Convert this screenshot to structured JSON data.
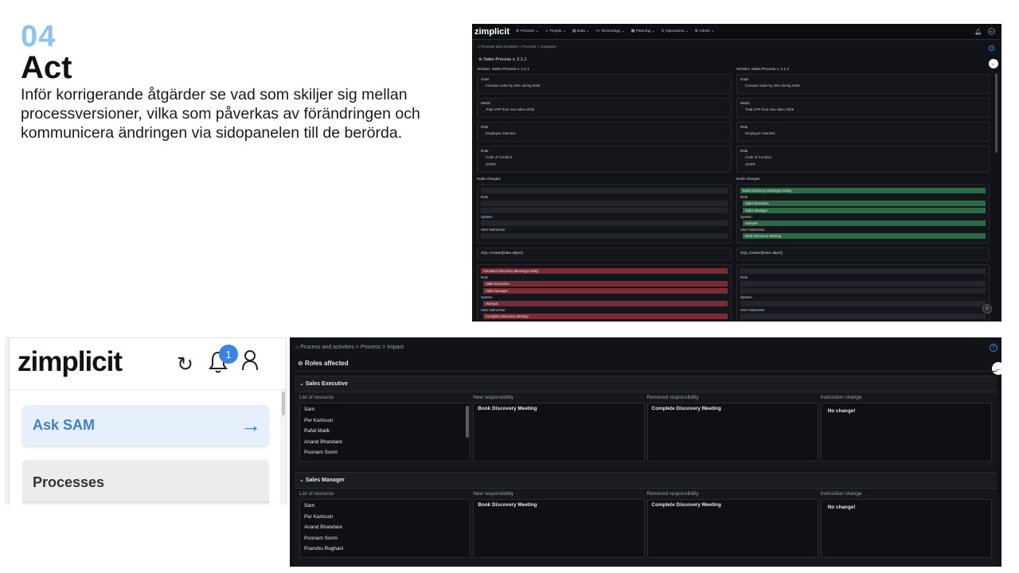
{
  "slide": {
    "number": "04",
    "title": "Act",
    "description": "Inför korrigerande åtgärder se vad som skiljer sig mellan processversioner, vilka som påverkas av förändringen och kommunicera ändringen via sidopanelen till de berörda."
  },
  "compare": {
    "logo": "zimplicit",
    "nav": [
      "Process",
      "People",
      "Data",
      "Technology",
      "Planning",
      "Operations",
      "Admin"
    ],
    "avatar": "MJ",
    "breadcrumb": "Process and activities  >  Process  >  Compare",
    "page_title": "Sales Process v. 2.1.1",
    "left": {
      "version": "Version: Sales Process v. 2.1.1",
      "goal_label": "Goal",
      "goal": "Increase sales by 25% during 2025",
      "metric_label": "Metric",
      "metric": "Total APR from new sales 2025",
      "risk_label": "Risk",
      "risk": "Employee retention",
      "rule_label": "Rule",
      "rule1": "Code of Conduct",
      "rule2": "GDPR",
      "node_changes": "Node changes",
      "role": "Role",
      "system": "System",
      "user_instruction": "User instruction",
      "sql": "SQL.Created(Data object)",
      "removed_activity": "Complete Discovery Meeting(Activity)",
      "role2": "Role",
      "role_a": "Sales Executive",
      "role_b": "Sales Manager",
      "system2": "System",
      "system_a": "Hubspot",
      "ui2": "User instruction",
      "ui_a": "Complete Discovery Meeting"
    },
    "right": {
      "version": "Version: Sales Process v. 2.1.2",
      "goal_label": "Goal",
      "goal": "Increase sales by 25% during 2025",
      "metric_label": "Metric",
      "metric": "Total APR from new sales 2025",
      "risk_label": "Risk",
      "risk": "Employee retention",
      "rule_label": "Rule",
      "rule1": "Code of Conduct",
      "rule2": "GDPR",
      "node_changes": "Node changes",
      "added_activity": "Book Discovery Meeting(Activity)",
      "role": "Role",
      "role_a": "Sales Executive",
      "role_b": "Sales Manager",
      "system": "System",
      "system_a": "Hubspot",
      "user_instruction": "User instruction",
      "ui_a": "Book Discovery Meeting",
      "sql": "SQL.Created(Data object)",
      "role2": "Role",
      "system2": "System",
      "ui2": "User instruction"
    }
  },
  "panel": {
    "logo": "zimplicit",
    "notification_count": "1",
    "ask_label": "Ask SAM",
    "processes_label": "Processes"
  },
  "impact": {
    "breadcrumb": "Process and activities  >  Process  >  Impact",
    "page_title": "Roles affected",
    "columns": [
      "List of resource",
      "New responsibility",
      "Removed responsibility",
      "Instruction change"
    ],
    "groups": [
      {
        "name": "Sales Executive",
        "resources": [
          "Sam",
          "Per Karlsson",
          "Rafat Malik",
          "Anand Bhandare",
          "Poonam Sonni"
        ],
        "new": "Book Discovery Meeting",
        "removed": "Complete Discovery Meeting",
        "instruction": "No change!"
      },
      {
        "name": "Sales Manager",
        "resources": [
          "Sam",
          "Per Karlsson",
          "Anand Bhandare",
          "Poonam Sonni",
          "Pranshu Rughani"
        ],
        "new": "Book Discovery Meeting",
        "removed": "Complete Discovery Meeting",
        "instruction": "No change!"
      }
    ]
  }
}
